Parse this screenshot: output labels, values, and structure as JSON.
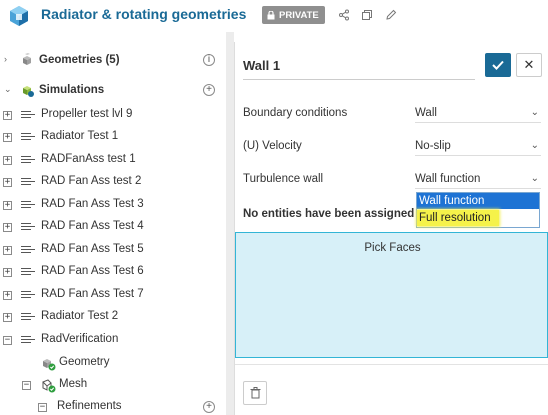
{
  "header": {
    "title": "Radiator & rotating geometries",
    "private_label": "PRIVATE",
    "accent_color": "#1a6a96"
  },
  "tree": {
    "geometries_label": "Geometries (5)",
    "simulations_label": "Simulations",
    "items": [
      {
        "label": "Propeller test lvl 9"
      },
      {
        "label": "Radiator Test 1"
      },
      {
        "label": "RADFanAss test 1"
      },
      {
        "label": "RAD Fan Ass test 2"
      },
      {
        "label": "RAD Fan Ass Test 3"
      },
      {
        "label": "RAD Fan Ass Test 4"
      },
      {
        "label": "RAD Fan Ass Test 5"
      },
      {
        "label": "RAD Fan Ass Test 6"
      },
      {
        "label": "RAD Fan Ass Test 7"
      },
      {
        "label": "Radiator Test 2"
      },
      {
        "label": "RadVerification"
      }
    ],
    "children": {
      "geometry_label": "Geometry",
      "mesh_label": "Mesh",
      "refinements_label": "Refinements"
    }
  },
  "panel": {
    "name_value": "Wall 1",
    "fields": {
      "boundary_label": "Boundary conditions",
      "boundary_value": "Wall",
      "velocity_label": "(U) Velocity",
      "velocity_value": "No-slip",
      "turbulence_label": "Turbulence wall",
      "turbulence_value": "Wall function"
    },
    "dropdown_options": [
      "Wall function",
      "Full resolution"
    ],
    "no_entities": "No entities have been assigned",
    "pick_faces": "Pick Faces"
  }
}
